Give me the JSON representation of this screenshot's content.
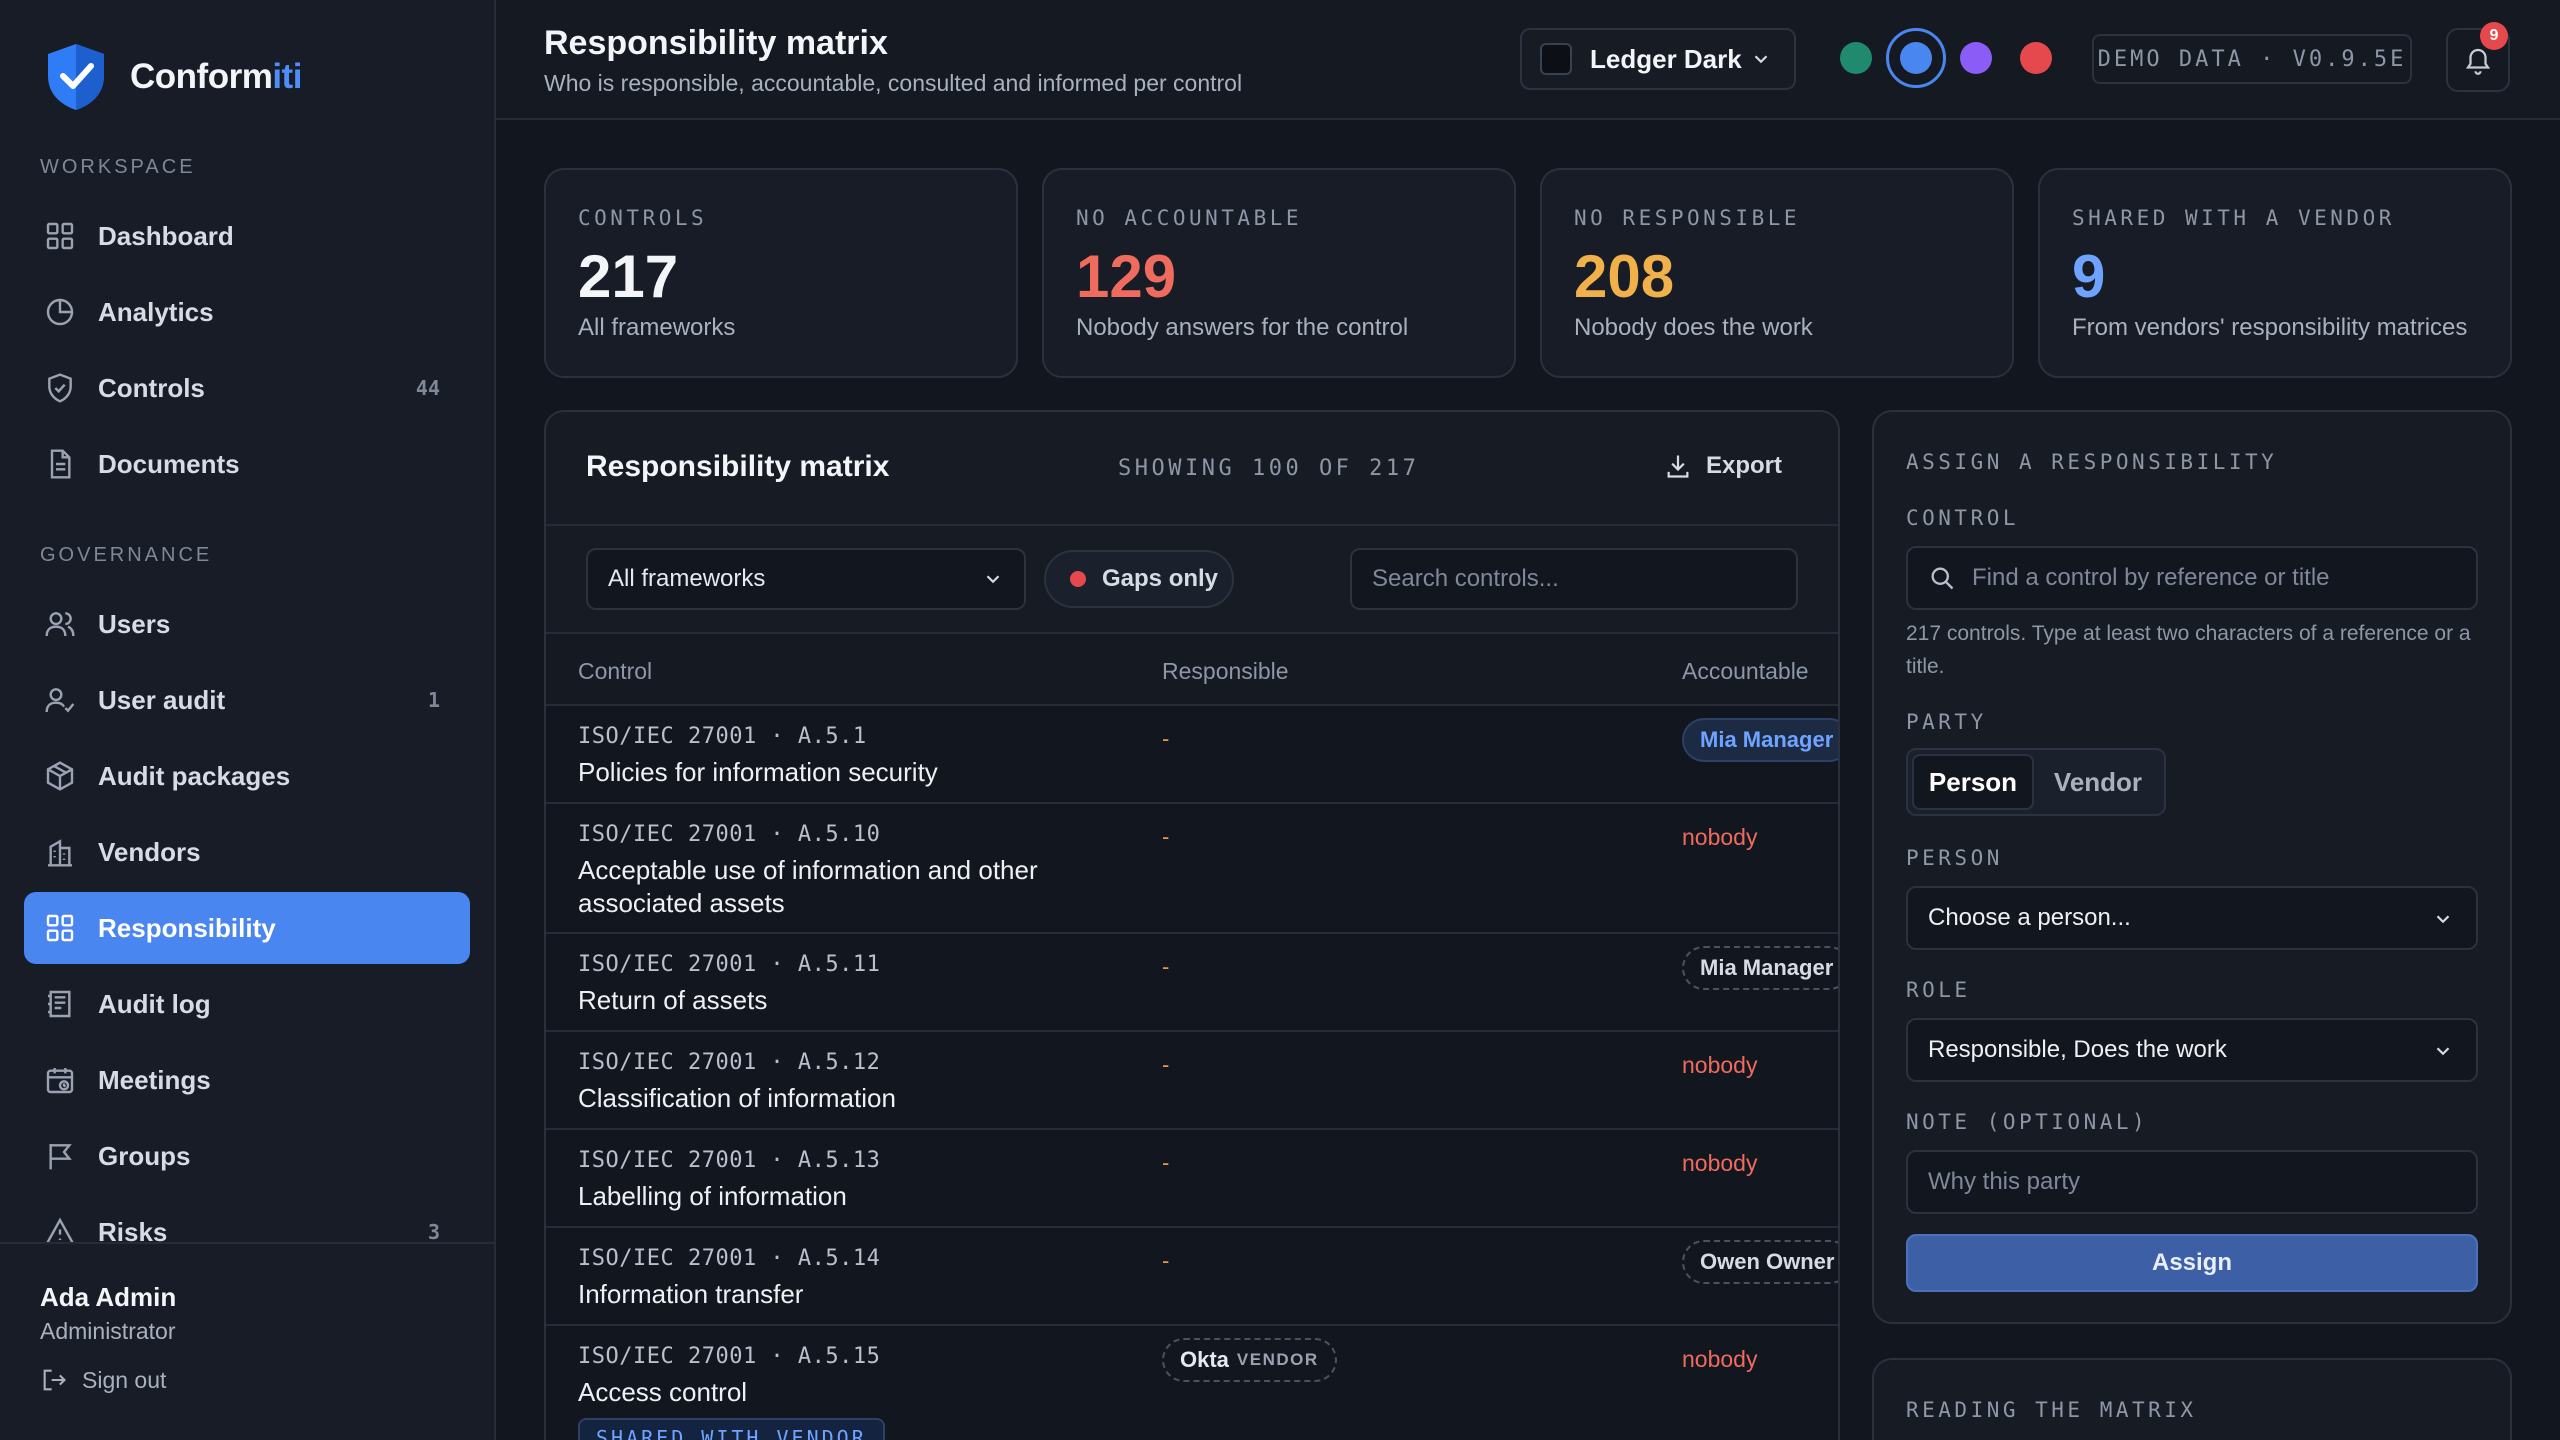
{
  "brand": {
    "name_main": "Conform",
    "name_accent": "iti"
  },
  "sidebar": {
    "workspace_label": "WORKSPACE",
    "governance_label": "GOVERNANCE",
    "workspace_items": [
      {
        "label": "Dashboard",
        "icon": "grid-icon",
        "badge": ""
      },
      {
        "label": "Analytics",
        "icon": "pie-chart-icon",
        "badge": ""
      },
      {
        "label": "Controls",
        "icon": "shield-check-icon",
        "badge": "44"
      },
      {
        "label": "Documents",
        "icon": "document-icon",
        "badge": ""
      }
    ],
    "governance_items": [
      {
        "label": "Users",
        "icon": "users-icon",
        "badge": ""
      },
      {
        "label": "User audit",
        "icon": "user-check-icon",
        "badge": "1"
      },
      {
        "label": "Audit packages",
        "icon": "package-icon",
        "badge": ""
      },
      {
        "label": "Vendors",
        "icon": "building-icon",
        "badge": ""
      },
      {
        "label": "Responsibility",
        "icon": "grid-icon",
        "badge": "",
        "active": true
      },
      {
        "label": "Audit log",
        "icon": "log-icon",
        "badge": ""
      },
      {
        "label": "Meetings",
        "icon": "calendar-clock-icon",
        "badge": ""
      },
      {
        "label": "Groups",
        "icon": "flag-icon",
        "badge": ""
      },
      {
        "label": "Risks",
        "icon": "warning-icon",
        "badge": "3"
      }
    ],
    "user": {
      "name": "Ada Admin",
      "role": "Administrator",
      "signout": "Sign out"
    }
  },
  "header": {
    "title": "Responsibility matrix",
    "subtitle": "Who is responsible, accountable, consulted and informed per control",
    "theme": "Ledger Dark",
    "accent_dots": [
      "#1f8a6e",
      "#4a86f0",
      "#8b5cf6",
      "#e5484d"
    ],
    "selected_accent": "#4a86f0",
    "demo_label": "DEMO DATA · V0.9.5E",
    "notifications": "9"
  },
  "stats": [
    {
      "label": "CONTROLS",
      "value": "217",
      "desc": "All frameworks",
      "color": "#f3f5f9"
    },
    {
      "label": "NO ACCOUNTABLE",
      "value": "129",
      "desc": "Nobody answers for the control",
      "color": "#ef6b5e"
    },
    {
      "label": "NO RESPONSIBLE",
      "value": "208",
      "desc": "Nobody does the work",
      "color": "#f0b04a"
    },
    {
      "label": "SHARED WITH A VENDOR",
      "value": "9",
      "desc": "From vendors' responsibility matrices",
      "color": "#6ea4ff"
    }
  ],
  "matrix": {
    "title": "Responsibility matrix",
    "showing": "SHOWING 100 OF 217",
    "export": "Export",
    "framework_filter": "All frameworks",
    "gaps_only": "Gaps only",
    "search_placeholder": "Search controls...",
    "columns": {
      "control": "Control",
      "responsible": "Responsible",
      "accountable": "Accountable"
    },
    "rows": [
      {
        "ref": "ISO/IEC 27001 · A.5.1",
        "title": "Policies for information security",
        "responsible": "-",
        "accountable": "Mia Manager",
        "acc_style": "blue"
      },
      {
        "ref": "ISO/IEC 27001 · A.5.10",
        "title": "Acceptable use of information and other associated assets",
        "responsible": "-",
        "accountable": "nobody",
        "acc_style": "nobody"
      },
      {
        "ref": "ISO/IEC 27001 · A.5.11",
        "title": "Return of assets",
        "responsible": "-",
        "accountable": "Mia Manager",
        "acc_style": "dashed"
      },
      {
        "ref": "ISO/IEC 27001 · A.5.12",
        "title": "Classification of information",
        "responsible": "-",
        "accountable": "nobody",
        "acc_style": "nobody"
      },
      {
        "ref": "ISO/IEC 27001 · A.5.13",
        "title": "Labelling of information",
        "responsible": "-",
        "accountable": "nobody",
        "acc_style": "nobody"
      },
      {
        "ref": "ISO/IEC 27001 · A.5.14",
        "title": "Information transfer",
        "responsible": "-",
        "accountable": "Owen Owner",
        "acc_style": "dashed"
      },
      {
        "ref": "ISO/IEC 27001 · A.5.15",
        "title": "Access control",
        "responsible_vendor": "Okta",
        "vendor_tag": "VENDOR",
        "accountable": "nobody",
        "acc_style": "nobody",
        "shared_tag": "SHARED WITH VENDOR"
      }
    ]
  },
  "assign": {
    "heading": "ASSIGN A RESPONSIBILITY",
    "control_label": "CONTROL",
    "control_placeholder": "Find a control by reference or title",
    "control_help": "217 controls. Type at least two characters of a reference or a title.",
    "party_label": "PARTY",
    "party_options": [
      "Person",
      "Vendor"
    ],
    "party_selected": "Person",
    "person_label": "PERSON",
    "person_value": "Choose a person...",
    "role_label": "ROLE",
    "role_value": "Responsible, Does the work",
    "note_label": "NOTE (OPTIONAL)",
    "note_placeholder": "Why this party",
    "assign_button": "Assign"
  },
  "reading": {
    "heading": "READING THE MATRIX"
  }
}
